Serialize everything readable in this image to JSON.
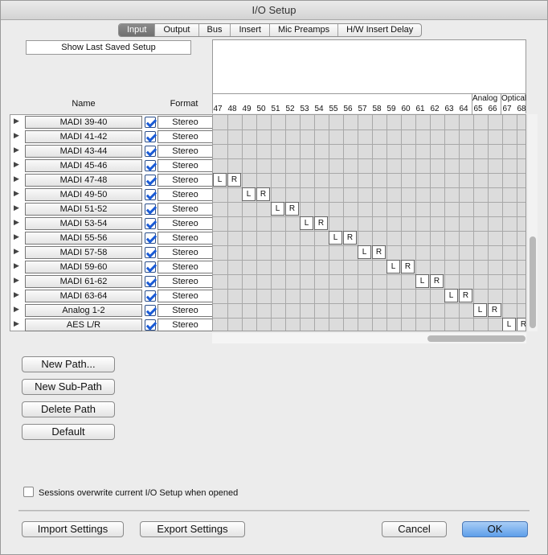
{
  "window": {
    "title": "I/O Setup"
  },
  "tabs": [
    "Input",
    "Output",
    "Bus",
    "Insert",
    "Mic Preamps",
    "H/W Insert Delay"
  ],
  "show_last_saved": "Show Last Saved Setup",
  "columns": {
    "name": "Name",
    "format": "Format"
  },
  "channel_numbers": [
    "47",
    "48",
    "49",
    "50",
    "51",
    "52",
    "53",
    "54",
    "55",
    "56",
    "57",
    "58",
    "59",
    "60",
    "61",
    "62",
    "63",
    "64",
    "65",
    "66",
    "67",
    "68"
  ],
  "groups": [
    {
      "label": "Analog",
      "start_index": 18
    },
    {
      "label": "Optical",
      "start_index": 20
    }
  ],
  "paths": [
    {
      "name": "MADI 39-40",
      "format": "Stereo",
      "active": true,
      "assign_start": null
    },
    {
      "name": "MADI 41-42",
      "format": "Stereo",
      "active": true,
      "assign_start": null
    },
    {
      "name": "MADI 43-44",
      "format": "Stereo",
      "active": true,
      "assign_start": null
    },
    {
      "name": "MADI 45-46",
      "format": "Stereo",
      "active": true,
      "assign_start": null
    },
    {
      "name": "MADI 47-48",
      "format": "Stereo",
      "active": true,
      "assign_start": 0
    },
    {
      "name": "MADI 49-50",
      "format": "Stereo",
      "active": true,
      "assign_start": 2
    },
    {
      "name": "MADI 51-52",
      "format": "Stereo",
      "active": true,
      "assign_start": 4
    },
    {
      "name": "MADI 53-54",
      "format": "Stereo",
      "active": true,
      "assign_start": 6
    },
    {
      "name": "MADI 55-56",
      "format": "Stereo",
      "active": true,
      "assign_start": 8
    },
    {
      "name": "MADI 57-58",
      "format": "Stereo",
      "active": true,
      "assign_start": 10
    },
    {
      "name": "MADI 59-60",
      "format": "Stereo",
      "active": true,
      "assign_start": 12
    },
    {
      "name": "MADI 61-62",
      "format": "Stereo",
      "active": true,
      "assign_start": 14
    },
    {
      "name": "MADI 63-64",
      "format": "Stereo",
      "active": true,
      "assign_start": 16
    },
    {
      "name": "Analog 1-2",
      "format": "Stereo",
      "active": true,
      "assign_start": 18
    },
    {
      "name": "AES L/R",
      "format": "Stereo",
      "active": true,
      "assign_start": 20
    }
  ],
  "assign_labels": [
    "L",
    "R"
  ],
  "buttons": {
    "new_path": "New Path...",
    "new_sub_path": "New Sub-Path",
    "delete_path": "Delete Path",
    "default": "Default",
    "import": "Import Settings",
    "export": "Export Settings",
    "cancel": "Cancel",
    "ok": "OK"
  },
  "sessions_overwrite": {
    "label": "Sessions overwrite current I/O Setup when opened",
    "checked": false
  }
}
